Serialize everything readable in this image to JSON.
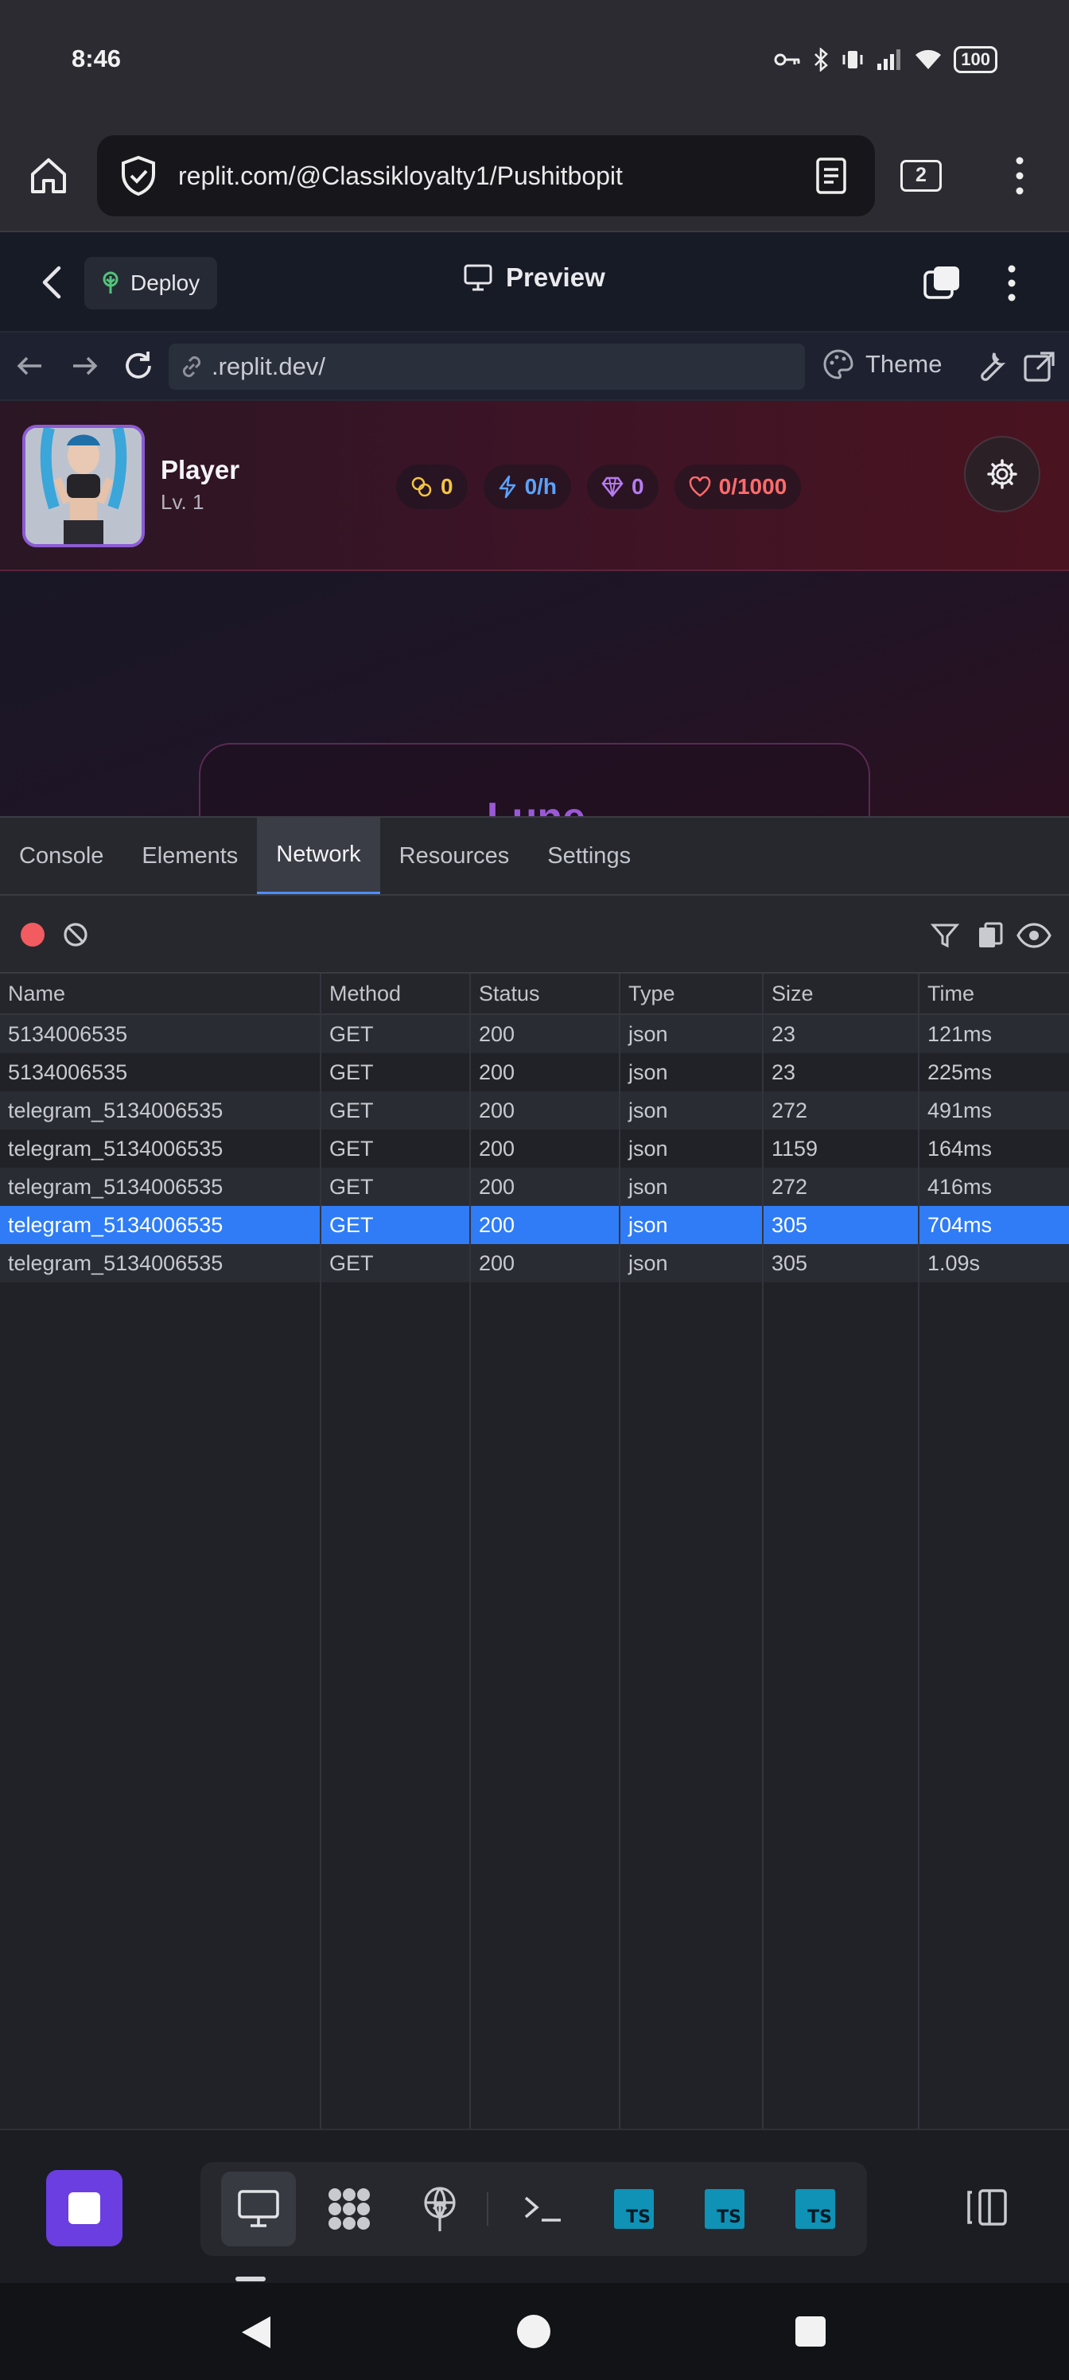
{
  "status_bar": {
    "time": "8:46",
    "battery": "100"
  },
  "browser": {
    "url": "replit.com/@Classikloyalty1/Pushitbopit",
    "tab_count": "2"
  },
  "replit_header": {
    "deploy_label": "Deploy",
    "title": "Preview"
  },
  "preview_nav": {
    "address": ".replit.dev/",
    "theme_label": "Theme"
  },
  "app": {
    "player_name": "Player",
    "player_level": "Lv. 1",
    "stats": {
      "coins": "0",
      "rate": "0/h",
      "gems": "0",
      "hearts": "0/1000"
    },
    "card_title": "Lune",
    "colors": {
      "coins": "#f4c542",
      "rate": "#5aa2ff",
      "gems": "#b77cf2",
      "hearts": "#ff6b6b"
    }
  },
  "devtools": {
    "tabs": [
      {
        "label": "Console"
      },
      {
        "label": "Elements"
      },
      {
        "label": "Network"
      },
      {
        "label": "Resources"
      },
      {
        "label": "Settings"
      }
    ],
    "active_tab": "Network",
    "columns": [
      "Name",
      "Method",
      "Status",
      "Type",
      "Size",
      "Time"
    ],
    "rows": [
      {
        "name": "5134006535",
        "method": "GET",
        "status": "200",
        "type": "json",
        "size": "23",
        "time": "121ms"
      },
      {
        "name": "5134006535",
        "method": "GET",
        "status": "200",
        "type": "json",
        "size": "23",
        "time": "225ms"
      },
      {
        "name": "telegram_5134006535",
        "method": "GET",
        "status": "200",
        "type": "json",
        "size": "272",
        "time": "491ms"
      },
      {
        "name": "telegram_5134006535",
        "method": "GET",
        "status": "200",
        "type": "json",
        "size": "1159",
        "time": "164ms"
      },
      {
        "name": "telegram_5134006535",
        "method": "GET",
        "status": "200",
        "type": "json",
        "size": "272",
        "time": "416ms"
      },
      {
        "name": "telegram_5134006535",
        "method": "GET",
        "status": "200",
        "type": "json",
        "size": "305",
        "time": "704ms"
      },
      {
        "name": "telegram_5134006535",
        "method": "GET",
        "status": "200",
        "type": "json",
        "size": "305",
        "time": "1.09s"
      }
    ],
    "selected_row": 5
  },
  "bottom_toolbar": {
    "ts_label": "TS",
    "accent": "#6a3ee0"
  }
}
